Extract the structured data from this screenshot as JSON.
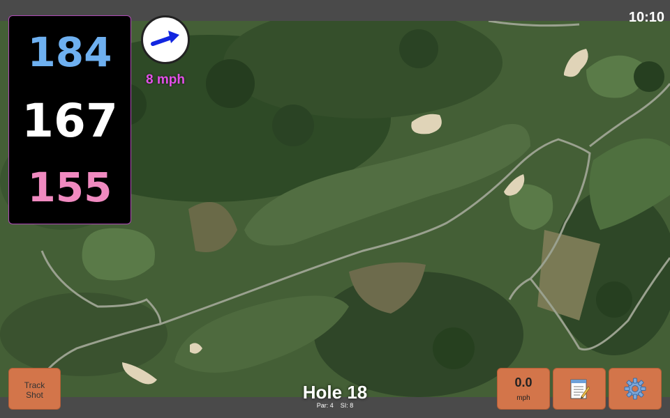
{
  "status": {
    "time": "10:10"
  },
  "yardages": {
    "back": "184",
    "middle": "167",
    "front": "155"
  },
  "wind": {
    "speed": "8 mph",
    "icon": "wind-arrow-icon"
  },
  "hole": {
    "title": "Hole 18",
    "par": "Par: 4",
    "si": "SI: 8"
  },
  "buttons": {
    "track_line1": "Track",
    "track_line2": "Shot",
    "speed_value": "0.0",
    "speed_unit": "mph",
    "notes_icon": "notepad-icon",
    "settings_icon": "gear-icon"
  },
  "colors": {
    "back": "#6eb0f0",
    "middle": "#ffffff",
    "front": "#f08ac0",
    "wind": "#e34fe8",
    "button": "#d3754a"
  }
}
